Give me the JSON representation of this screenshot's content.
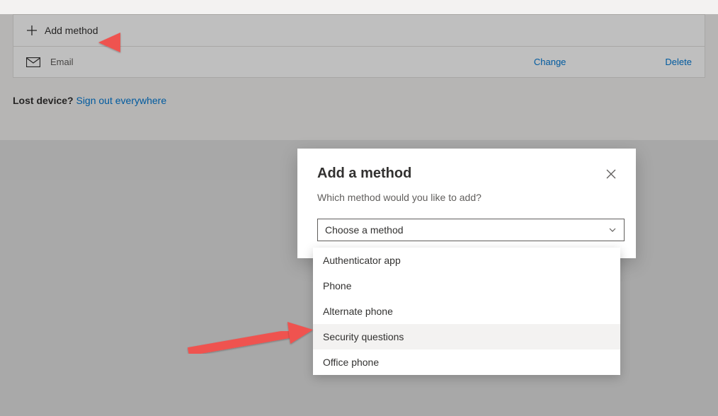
{
  "toolbar": {
    "add_method_label": "Add method"
  },
  "methods": {
    "email_label": "Email",
    "change_label": "Change",
    "delete_label": "Delete"
  },
  "lost_device": {
    "prompt": "Lost device?",
    "signout": "Sign out everywhere"
  },
  "dialog": {
    "title": "Add a method",
    "subtitle": "Which method would you like to add?",
    "select_placeholder": "Choose a method",
    "options": {
      "authenticator": "Authenticator app",
      "phone": "Phone",
      "alternate_phone": "Alternate phone",
      "security_questions": "Security questions",
      "office_phone": "Office phone"
    }
  }
}
